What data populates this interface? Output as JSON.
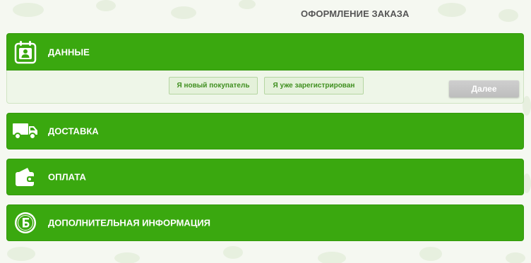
{
  "page": {
    "title": "ОФОРМЛЕНИЕ ЗАКАЗА"
  },
  "colors": {
    "accent_green": "#3aa80f",
    "panel_body": "#eef6e8",
    "choice_button_text": "#3f8f1f",
    "next_button_disabled": "#c6c6c6",
    "title_text": "#555555"
  },
  "sections": [
    {
      "label": "ДАННЫЕ",
      "icon": "calendar-user-icon",
      "expanded": true
    },
    {
      "label": "ДОСТАВКА",
      "icon": "truck-icon",
      "expanded": false
    },
    {
      "label": "ОПЛАТА",
      "icon": "wallet-icon",
      "expanded": false
    },
    {
      "label": "ДОПОЛНИТЕЛЬНАЯ ИНФОРМАЦИЯ",
      "icon": "ruble-coin-icon",
      "expanded": false
    }
  ],
  "customer": {
    "new_customer_label": "Я новый покупатель",
    "registered_label": "Я уже зарегистрирован",
    "next_label": "Далее"
  }
}
